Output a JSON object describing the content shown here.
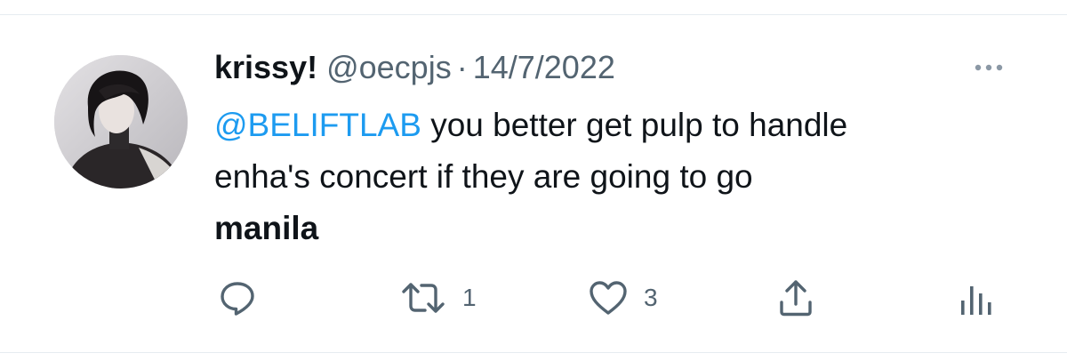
{
  "tweet": {
    "display_name": "krissy!",
    "handle": "@oecpjs",
    "separator": "·",
    "date": "14/7/2022",
    "text_mention": "@BELIFTLAB",
    "text_line1": " you better get pulp to handle",
    "text_line2": "enha's concert if they are going to go",
    "text_bold": "manila",
    "reply_count": "",
    "retweet_count": "1",
    "like_count": "3",
    "icons": {
      "avatar": "profile-photo",
      "more": "more-dots-icon",
      "reply": "reply-icon",
      "retweet": "retweet-icon",
      "like": "heart-icon",
      "share": "share-icon",
      "analytics": "analytics-icon"
    },
    "colors": {
      "mention": "#1d9bf0",
      "text": "#0f1419",
      "secondary": "#536471"
    }
  }
}
